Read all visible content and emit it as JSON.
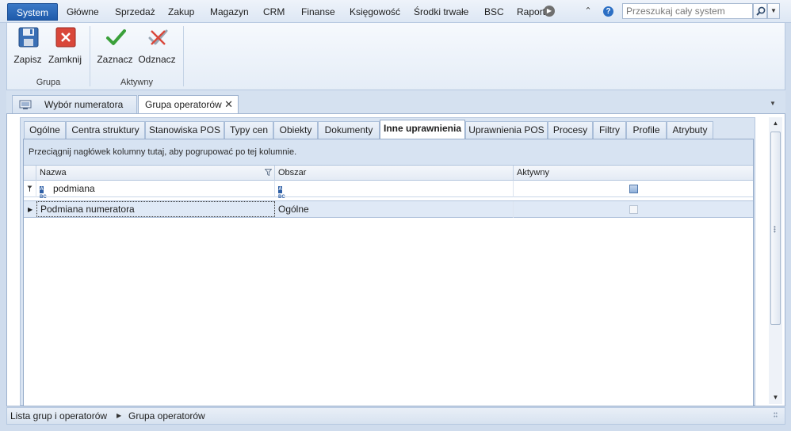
{
  "menu": {
    "items": [
      "System",
      "Główne",
      "Sprzedaż",
      "Zakup",
      "Magazyn",
      "CRM",
      "Finanse",
      "Księgowość",
      "Środki trwałe",
      "BSC",
      "Raport"
    ],
    "search_placeholder": "Przeszukaj cały system",
    "accent_color": "#2a68b9"
  },
  "ribbon": {
    "buttons": {
      "save": "Zapisz",
      "close": "Zamknij",
      "check": "Zaznacz",
      "uncheck": "Odznacz"
    },
    "groups": {
      "grupa": "Grupa",
      "aktywny": "Aktywny"
    }
  },
  "doc_tabs": {
    "first": "Wybór numeratora",
    "active": "Grupa operatorów"
  },
  "panel_tabs": [
    "Ogólne",
    "Centra struktury",
    "Stanowiska POS",
    "Typy cen",
    "Obiekty",
    "Dokumenty",
    "Inne uprawnienia",
    "Uprawnienia POS",
    "Procesy",
    "Filtry",
    "Profile",
    "Atrybuty"
  ],
  "active_panel_tab": "Inne uprawnienia",
  "grid": {
    "group_hint": "Przeciągnij nagłówek kolumny tutaj, aby pogrupować po tej kolumnie.",
    "columns": [
      "Nazwa",
      "Obszar",
      "Aktywny"
    ],
    "filter_row": {
      "nazwa": "podmiana",
      "obszar": "",
      "abc_icon": "ABC"
    },
    "rows": [
      {
        "nazwa": "Podmiana numeratora",
        "obszar": "Ogólne",
        "aktywny": false
      }
    ]
  },
  "status": {
    "crumbs": [
      "Lista grup i operatorów",
      "Grupa operatorów"
    ]
  }
}
